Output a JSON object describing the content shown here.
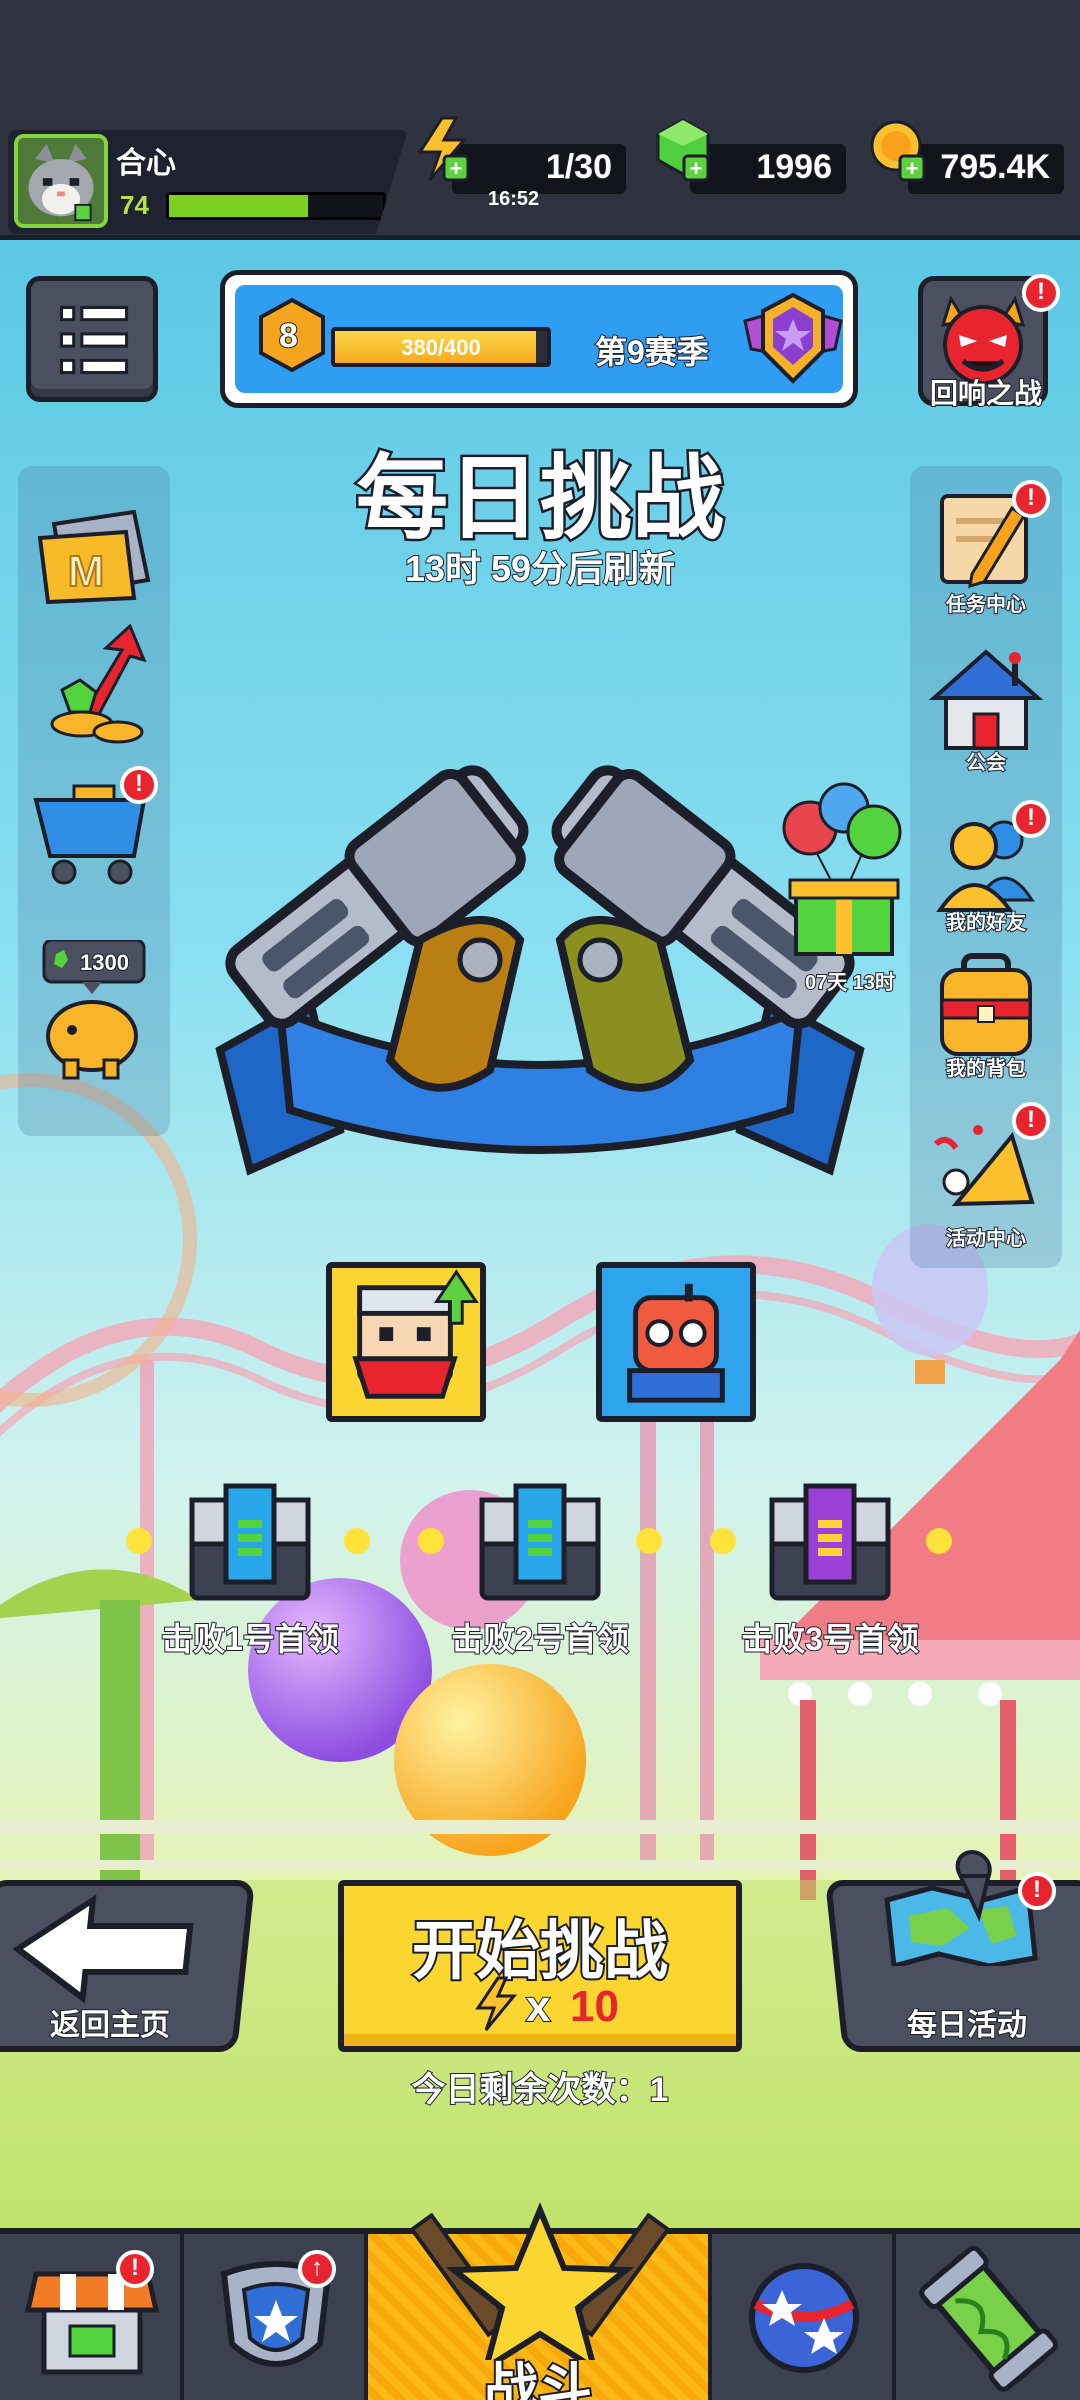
{
  "player": {
    "name": "合心",
    "level": "74",
    "xp_fraction": 0.65
  },
  "resources": {
    "energy": "1/30",
    "energy_timer": "16:52",
    "gems": "1996",
    "coins": "795.4K"
  },
  "season": {
    "level": "8",
    "progress": "380/400",
    "progress_fraction": 0.95,
    "name": "第9赛季"
  },
  "echo_battle": {
    "label": "回响之战",
    "badge": "!"
  },
  "left_panel": {
    "items": [
      {
        "name": "m-card",
        "badge": ""
      },
      {
        "name": "growth-fund",
        "badge": ""
      },
      {
        "name": "shop-cart",
        "badge": "!"
      },
      {
        "name": "piggy-bank",
        "price": "1300",
        "badge": ""
      }
    ]
  },
  "right_panel": {
    "items": [
      {
        "label": "任务中心",
        "badge": "!"
      },
      {
        "label": "公会",
        "badge": ""
      },
      {
        "label": "我的好友",
        "badge": "!"
      },
      {
        "label": "我的背包",
        "badge": ""
      },
      {
        "label": "活动中心",
        "badge": "!"
      }
    ]
  },
  "gift_timer": "07天 13时",
  "title": "每日挑战",
  "refresh_text": "13时 59分后刷新",
  "rewards": [
    {
      "label": "击败1号首领"
    },
    {
      "label": "击败2号首领"
    },
    {
      "label": "击败3号首领"
    }
  ],
  "back_button": {
    "label": "返回主页"
  },
  "start_button": {
    "label": "开始挑战",
    "cost_prefix": "x",
    "cost": "10"
  },
  "remaining": "今日剩余次数：1",
  "daily_activity": {
    "label": "每日活动",
    "badge": "!"
  },
  "nav": {
    "tabs": [
      {
        "name": "shop",
        "badge": "!"
      },
      {
        "name": "equipment",
        "badge": "↑"
      },
      {
        "name": "battle",
        "label": "战斗"
      },
      {
        "name": "talents",
        "badge": ""
      },
      {
        "name": "evolution",
        "badge": ""
      }
    ]
  },
  "colors": {
    "accent_yellow": "#fcd630",
    "badge_red": "#e8252f",
    "panel_dark": "#2f3340",
    "season_blue": "#2f9df2"
  }
}
